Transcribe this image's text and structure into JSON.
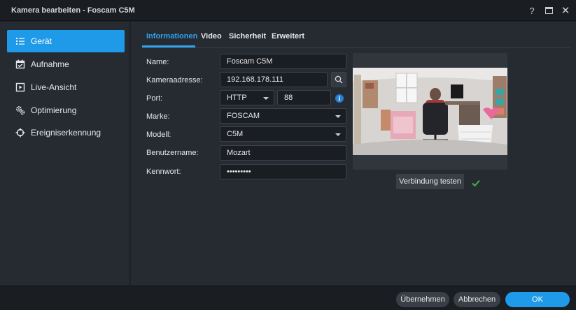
{
  "window": {
    "title": "Kamera bearbeiten - Foscam C5M",
    "help": "?",
    "close": "✕"
  },
  "sidebar": {
    "items": [
      {
        "label": "Gerät",
        "icon": "list-icon",
        "active": true
      },
      {
        "label": "Aufnahme",
        "icon": "calendar-check-icon"
      },
      {
        "label": "Live-Ansicht",
        "icon": "play-box-icon"
      },
      {
        "label": "Optimierung",
        "icon": "gears-icon"
      },
      {
        "label": "Ereigniserkennung",
        "icon": "crosshair-icon"
      }
    ]
  },
  "tabs": [
    {
      "label": "Informationen",
      "active": true
    },
    {
      "label": "Video"
    },
    {
      "label": "Sicherheit"
    },
    {
      "label": "Erweitert"
    }
  ],
  "form": {
    "name": {
      "label": "Name:",
      "value": "Foscam C5M"
    },
    "address": {
      "label": "Kameraadresse:",
      "value": "192.168.178.111"
    },
    "port": {
      "label": "Port:",
      "protocol": "HTTP",
      "value": "88"
    },
    "brand": {
      "label": "Marke:",
      "value": "FOSCAM"
    },
    "model": {
      "label": "Modell:",
      "value": "C5M"
    },
    "username": {
      "label": "Benutzername:",
      "value": "Mozart"
    },
    "password": {
      "label": "Kennwort:",
      "value": "•••••••••"
    }
  },
  "preview": {
    "test_button": "Verbindung testen",
    "status": "success"
  },
  "footer": {
    "apply": "Übernehmen",
    "cancel": "Abbrechen",
    "ok": "OK"
  },
  "colors": {
    "accent": "#1f9ae8",
    "success": "#3fb34f",
    "panel": "#262a31",
    "field": "#1a1d22"
  }
}
